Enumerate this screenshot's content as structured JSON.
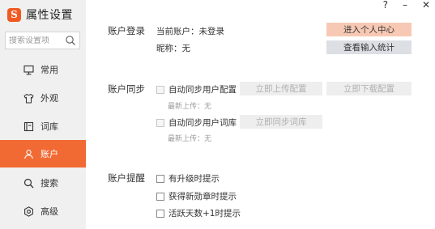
{
  "app": {
    "logo_glyph": "S",
    "title": "属性设置"
  },
  "window_controls": {
    "help": "?",
    "minimize": "–",
    "close": "✕"
  },
  "search": {
    "placeholder": "搜索设置项"
  },
  "nav": {
    "items": [
      {
        "label": "常用",
        "icon": "monitor-icon"
      },
      {
        "label": "外观",
        "icon": "shirt-icon"
      },
      {
        "label": "词库",
        "icon": "book-icon"
      },
      {
        "label": "账户",
        "icon": "user-icon",
        "active": true
      },
      {
        "label": "搜索",
        "icon": "search-icon"
      },
      {
        "label": "高级",
        "icon": "gear-icon"
      }
    ]
  },
  "account_login": {
    "section_label": "账户登录",
    "current_account": "当前账户：未登录",
    "nickname": "昵称：无",
    "personal_center_button": "进入个人中心",
    "input_stats_button": "查看输入统计"
  },
  "account_sync": {
    "section_label": "账户同步",
    "sync_config_label": "自动同步用户配置",
    "upload_config_button": "立即上传配置",
    "download_config_button": "立即下载配置",
    "config_last_upload": "最新上传：无",
    "sync_dict_label": "自动同步用户词库",
    "sync_dict_button": "立即同步词库",
    "dict_last_upload": "最新上传：无"
  },
  "account_reminder": {
    "section_label": "账户提醒",
    "options": [
      {
        "label": "有升级时提示"
      },
      {
        "label": "获得新勋章时提示"
      },
      {
        "label": "活跃天数+1时提示"
      }
    ]
  },
  "colors": {
    "accent": "#f26a33",
    "logo": "#f05a22",
    "orange_button": "#f7c9b4",
    "gray_button": "#dcdfe4",
    "sidebar": "#f0f0f0"
  }
}
